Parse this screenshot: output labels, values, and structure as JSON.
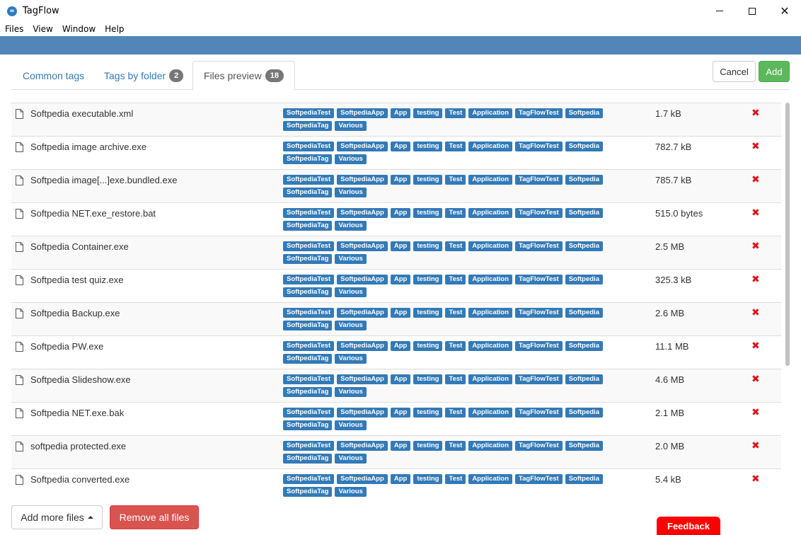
{
  "window": {
    "title": "TagFlow",
    "icon": "tagflow-logo-icon",
    "close_glyph": "✕"
  },
  "menu": [
    "Files",
    "View",
    "Window",
    "Help"
  ],
  "tabs": [
    {
      "label": "Common tags",
      "badge": null,
      "active": false
    },
    {
      "label": "Tags by folder",
      "badge": "2",
      "active": false
    },
    {
      "label": "Files preview",
      "badge": "18",
      "active": true
    }
  ],
  "actions": {
    "cancel": "Cancel",
    "add": "Add"
  },
  "tag_names": [
    "SoftpediaTest",
    "SoftpediaApp",
    "App",
    "testing",
    "Test",
    "Application",
    "TagFlowTest",
    "Softpedia",
    "SoftpediaTag",
    "Various"
  ],
  "files": [
    {
      "name": "Softpedia executable.xml",
      "size": "1.7 kB"
    },
    {
      "name": "Softpedia image archive.exe",
      "size": "782.7 kB"
    },
    {
      "name": "Softpedia image[...]exe.bundled.exe",
      "size": "785.7 kB"
    },
    {
      "name": "Softpedia NET.exe_restore.bat",
      "size": "515.0 bytes"
    },
    {
      "name": "Softpedia Container.exe",
      "size": "2.5 MB"
    },
    {
      "name": "Softpedia test quiz.exe",
      "size": "325.3 kB"
    },
    {
      "name": "Softpedia Backup.exe",
      "size": "2.6 MB"
    },
    {
      "name": "Softpedia PW.exe",
      "size": "11.1 MB"
    },
    {
      "name": "Softpedia Slideshow.exe",
      "size": "4.6 MB"
    },
    {
      "name": "Softpedia NET.exe.bak",
      "size": "2.1 MB"
    },
    {
      "name": "softpedia protected.exe",
      "size": "2.0 MB"
    },
    {
      "name": "Softpedia converted.exe",
      "size": "5.4 kB"
    }
  ],
  "bottom": {
    "add_more": "Add more files",
    "remove_all": "Remove all files",
    "feedback": "Feedback"
  },
  "colors": {
    "tag": "#337ab7",
    "remove": "#e0121a",
    "add_button": "#5cb85c",
    "remove_all_button": "#d9534f",
    "blue_band": "#5286b8"
  }
}
